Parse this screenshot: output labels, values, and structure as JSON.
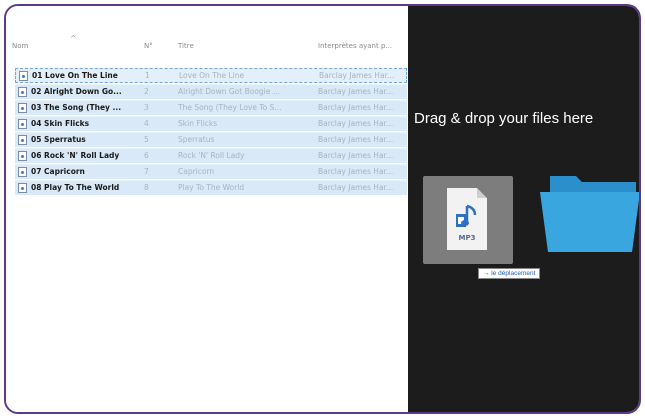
{
  "columns": {
    "name": "Nom",
    "number": "N°",
    "title": "Titre",
    "artists": "Interprètes ayant p..."
  },
  "rows": [
    {
      "name": "01 Love On The Line",
      "number": "1",
      "title": "Love On The Line",
      "artist": "Barclay James Har..."
    },
    {
      "name": "02 Alright Down Go...",
      "number": "2",
      "title": "Alright Down Got Boogie ...",
      "artist": "Barclay James Har..."
    },
    {
      "name": "03 The Song (They ...",
      "number": "3",
      "title": "The Song (They Love To S...",
      "artist": "Barclay James Har..."
    },
    {
      "name": "04 Skin Flicks",
      "number": "4",
      "title": "Skin Flicks",
      "artist": "Barclay James Har..."
    },
    {
      "name": "05 Sperratus",
      "number": "5",
      "title": "Sperratus",
      "artist": "Barclay James Har..."
    },
    {
      "name": "06 Rock 'N' Roll Lady",
      "number": "6",
      "title": "Rock 'N' Roll Lady",
      "artist": "Barclay James Har..."
    },
    {
      "name": "07 Capricorn",
      "number": "7",
      "title": "Capricorn",
      "artist": "Barclay James Har..."
    },
    {
      "name": "08 Play To The World",
      "number": "8",
      "title": "Play To The World",
      "artist": "Barclay James Har..."
    }
  ],
  "drop_zone": {
    "text": "Drag & drop your files here",
    "file_label": "MP3",
    "tooltip": "→ le déplacement"
  },
  "colors": {
    "frame": "#5b3a8c",
    "row_selected": "#d9e9f7",
    "drop_background": "#1c1c1c",
    "folder": "#2e9bd6"
  },
  "icons": {
    "file": "audio-file-icon",
    "mp3": "mp3-file-icon",
    "folder": "folder-icon"
  }
}
